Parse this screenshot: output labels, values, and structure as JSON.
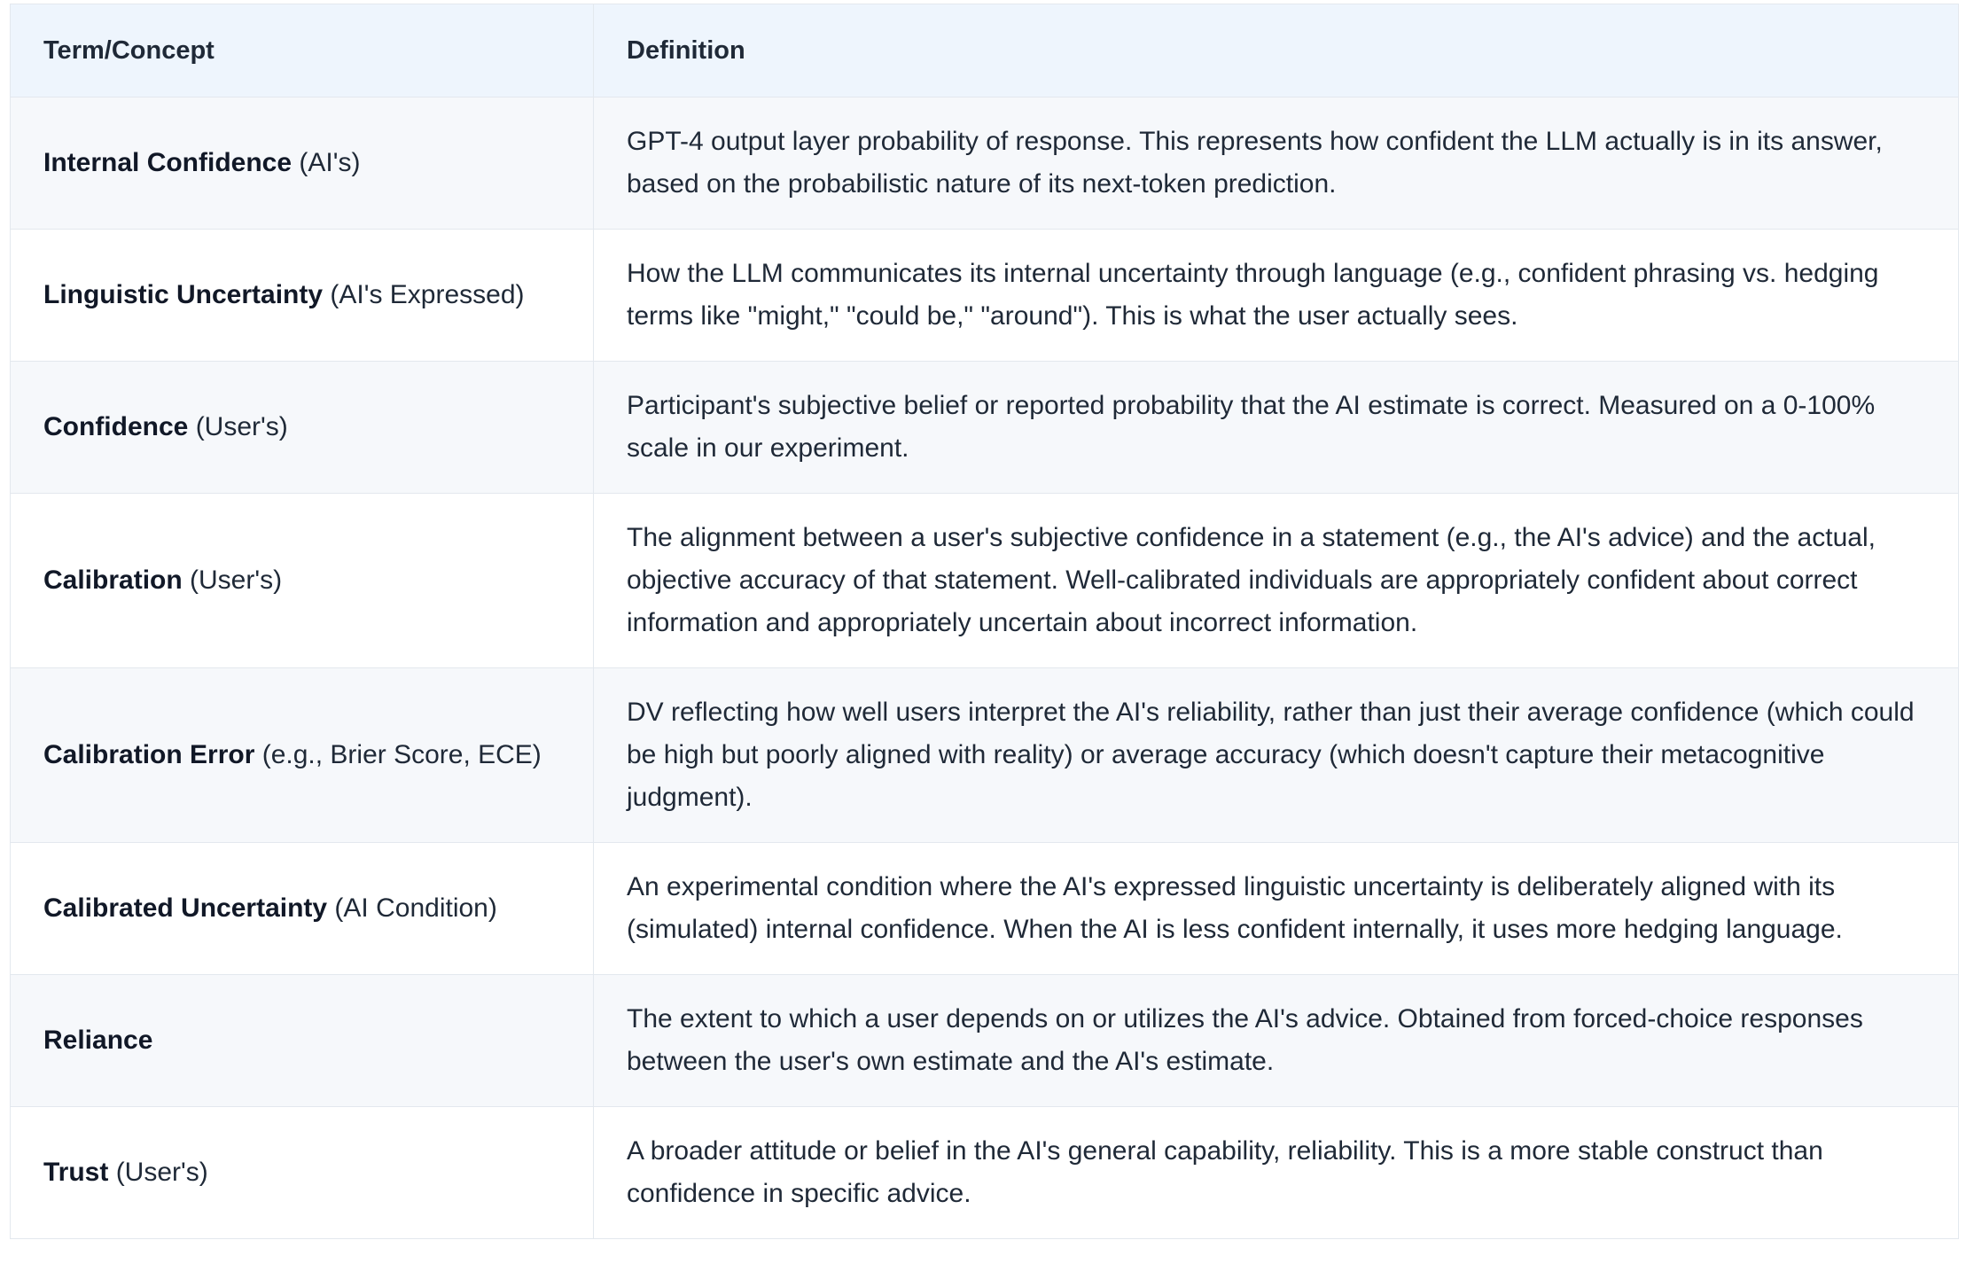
{
  "table": {
    "headers": [
      "Term/Concept",
      "Definition"
    ],
    "rows": [
      {
        "term": "Internal Confidence",
        "qualifier": " (AI's)",
        "definition": "GPT-4 output layer probability of response. This represents how confident the LLM actually is in its answer, based on the probabilistic nature of its next-token prediction."
      },
      {
        "term": "Linguistic Uncertainty",
        "qualifier": " (AI's Expressed)",
        "definition": "How the LLM communicates its internal uncertainty through language (e.g., confident phrasing vs. hedging terms like \"might,\" \"could be,\" \"around\"). This is what the user actually sees."
      },
      {
        "term": "Confidence",
        "qualifier": " (User's)",
        "definition": "Participant's subjective belief or reported probability that the AI estimate is correct. Measured on a 0-100% scale in our experiment."
      },
      {
        "term": "Calibration",
        "qualifier": " (User's)",
        "definition": "The alignment between a user's subjective confidence in a statement (e.g., the AI's advice) and the actual, objective accuracy of that statement. Well-calibrated individuals are appropriately confident about correct information and appropriately uncertain about incorrect information."
      },
      {
        "term": "Calibration Error",
        "qualifier": " (e.g., Brier Score, ECE)",
        "definition": "DV reflecting how well users interpret the AI's reliability, rather than just their average confidence (which could be high but poorly aligned with reality) or average accuracy (which doesn't capture their metacognitive judgment)."
      },
      {
        "term": "Calibrated Uncertainty",
        "qualifier": " (AI Condition)",
        "definition": "An experimental condition where the AI's expressed linguistic uncertainty is deliberately aligned with its (simulated) internal confidence. When the AI is less confident internally, it uses more hedging language."
      },
      {
        "term": "Reliance",
        "qualifier": "",
        "definition": "The extent to which a user depends on or utilizes the AI's advice. Obtained from forced-choice responses between the user's own estimate and the AI's estimate."
      },
      {
        "term": "Trust",
        "qualifier": " (User's)",
        "definition": "A broader attitude or belief in the AI's general capability, reliability. This is a more stable construct than confidence in specific advice."
      }
    ]
  }
}
